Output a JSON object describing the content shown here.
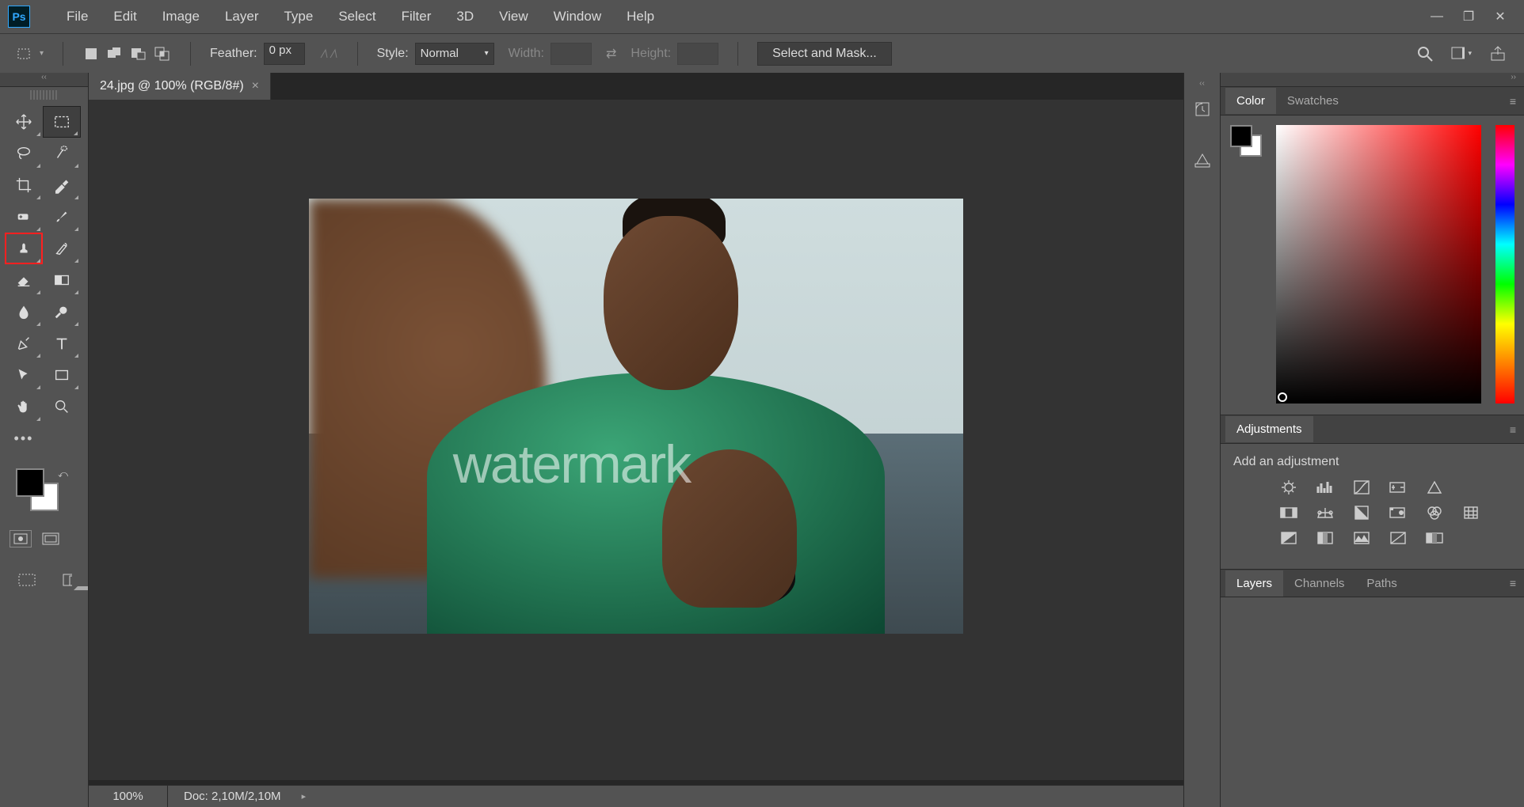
{
  "menu": {
    "items": [
      "File",
      "Edit",
      "Image",
      "Layer",
      "Type",
      "Select",
      "Filter",
      "3D",
      "View",
      "Window",
      "Help"
    ]
  },
  "options": {
    "feather_label": "Feather:",
    "feather_value": "0 px",
    "style_label": "Style:",
    "style_value": "Normal",
    "width_label": "Width:",
    "width_value": "",
    "height_label": "Height:",
    "height_value": "",
    "select_mask": "Select and Mask..."
  },
  "document": {
    "tab_title": "24.jpg @ 100% (RGB/8#)",
    "zoom": "100%",
    "doc_info": "Doc: 2,10M/2,10M",
    "watermark": "watermark"
  },
  "panels": {
    "color_tab": "Color",
    "swatches_tab": "Swatches",
    "adjustments_tab": "Adjustments",
    "add_adjustment": "Add an adjustment",
    "layers_tab": "Layers",
    "channels_tab": "Channels",
    "paths_tab": "Paths"
  }
}
